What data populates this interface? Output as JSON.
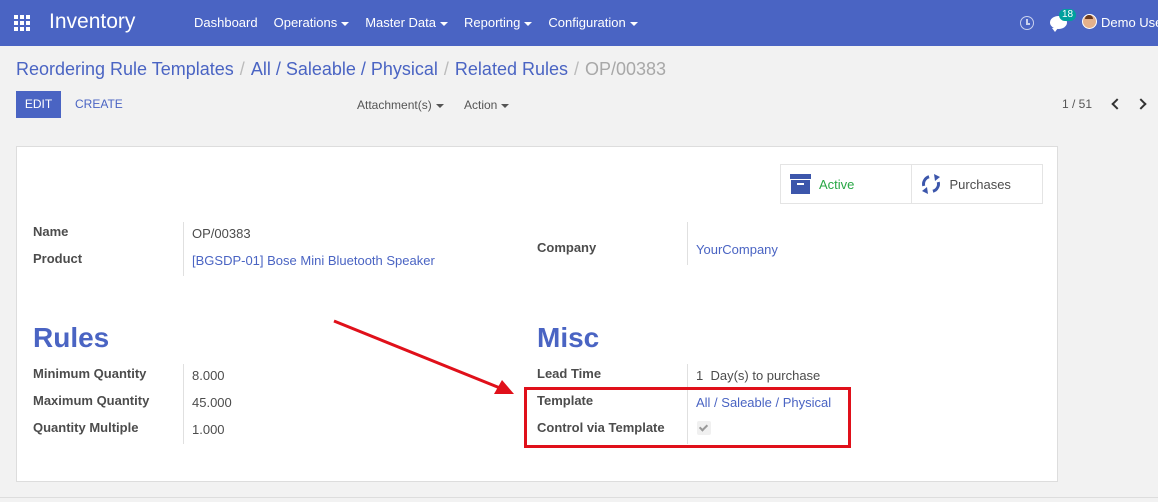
{
  "navbar": {
    "app_title": "Inventory",
    "menu": [
      {
        "label": "Dashboard",
        "has_caret": false
      },
      {
        "label": "Operations",
        "has_caret": true
      },
      {
        "label": "Master Data",
        "has_caret": true
      },
      {
        "label": "Reporting",
        "has_caret": true
      },
      {
        "label": "Configuration",
        "has_caret": true
      }
    ],
    "chat_count": "18",
    "user_name": "Demo Use",
    "color": "#4a64c3"
  },
  "breadcrumb": {
    "items": [
      "Reordering Rule Templates",
      "All / Saleable / Physical",
      "Related Rules"
    ],
    "current": "OP/00383"
  },
  "toolbar": {
    "edit_label": "EDIT",
    "create_label": "CREATE",
    "attachments_label": "Attachment(s)",
    "action_label": "Action",
    "pager": "1 / 51"
  },
  "smart_buttons": {
    "active_label": "Active",
    "active_icon": "archive-icon",
    "purchases_label": "Purchases",
    "purchases_icon": "sync-icon"
  },
  "form": {
    "name_label": "Name",
    "name_value": "OP/00383",
    "product_label": "Product",
    "product_value": "[BGSDP-01] Bose Mini Bluetooth Speaker",
    "company_label": "Company",
    "company_value": "YourCompany"
  },
  "rules": {
    "title": "Rules",
    "min_qty_label": "Minimum Quantity",
    "min_qty_value": "8.000",
    "max_qty_label": "Maximum Quantity",
    "max_qty_value": "45.000",
    "qty_multiple_label": "Quantity Multiple",
    "qty_multiple_value": "1.000"
  },
  "misc": {
    "title": "Misc",
    "lead_time_label": "Lead Time",
    "lead_time_value": "1",
    "lead_time_unit": "Day(s) to purchase",
    "template_label": "Template",
    "template_value": "All / Saleable / Physical",
    "control_label": "Control via Template",
    "control_checked": true
  },
  "annotation": {
    "color": "#e0101a"
  }
}
